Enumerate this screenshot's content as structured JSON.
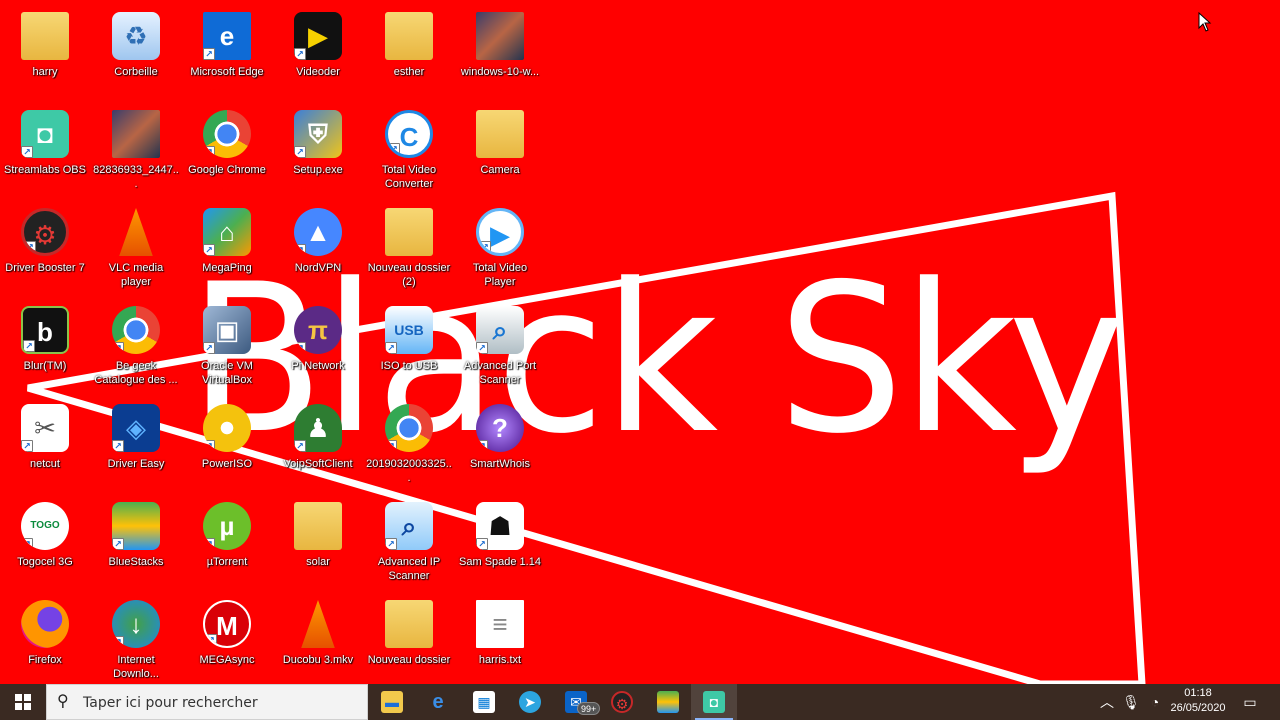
{
  "wallpaper": {
    "text": "Black Sky",
    "background": "#ff0000"
  },
  "desktop_icons": [
    {
      "label": "harry",
      "icon": "folder-icon"
    },
    {
      "label": "Corbeille",
      "icon": "recycle-bin-icon"
    },
    {
      "label": "Microsoft Edge",
      "icon": "edge-icon"
    },
    {
      "label": "Videoder",
      "icon": "videoder-icon"
    },
    {
      "label": "esther",
      "icon": "folder-icon"
    },
    {
      "label": "windows-10-w...",
      "icon": "image-file-icon"
    },
    {
      "label": "Streamlabs OBS",
      "icon": "streamlabs-icon"
    },
    {
      "label": "82836933_2447...",
      "icon": "image-file-icon"
    },
    {
      "label": "Google Chrome",
      "icon": "chrome-icon"
    },
    {
      "label": "Setup.exe",
      "icon": "setup-icon"
    },
    {
      "label": "Total Video Converter",
      "icon": "total-video-converter-icon"
    },
    {
      "label": "Camera",
      "icon": "folder-icon"
    },
    {
      "label": "Driver Booster 7",
      "icon": "driver-booster-icon"
    },
    {
      "label": "VLC media player",
      "icon": "vlc-icon"
    },
    {
      "label": "MegaPing",
      "icon": "megaping-icon"
    },
    {
      "label": "NordVPN",
      "icon": "nordvpn-icon"
    },
    {
      "label": "Nouveau dossier (2)",
      "icon": "folder-icon"
    },
    {
      "label": "Total Video Player",
      "icon": "total-video-player-icon"
    },
    {
      "label": "Blur(TM)",
      "icon": "blur-icon"
    },
    {
      "label": "Be geek Catalogue des ...",
      "icon": "chrome-icon"
    },
    {
      "label": "Oracle VM VirtualBox",
      "icon": "virtualbox-icon"
    },
    {
      "label": "Pi Network",
      "icon": "pi-network-icon"
    },
    {
      "label": "ISO to USB",
      "icon": "iso-to-usb-icon"
    },
    {
      "label": "Advanced Port Scanner",
      "icon": "port-scanner-icon"
    },
    {
      "label": "netcut",
      "icon": "netcut-icon"
    },
    {
      "label": "Driver Easy",
      "icon": "driver-easy-icon"
    },
    {
      "label": "PowerISO",
      "icon": "poweriso-icon"
    },
    {
      "label": "VoipSoftClient",
      "icon": "voip-icon"
    },
    {
      "label": "2019032003325...",
      "icon": "chrome-icon"
    },
    {
      "label": "SmartWhois",
      "icon": "smartwhois-icon"
    },
    {
      "label": "Togocel 3G",
      "icon": "togocel-icon"
    },
    {
      "label": "BlueStacks",
      "icon": "bluestacks-icon"
    },
    {
      "label": "µTorrent",
      "icon": "utorrent-icon"
    },
    {
      "label": "solar",
      "icon": "folder-icon"
    },
    {
      "label": "Advanced IP Scanner",
      "icon": "ip-scanner-icon"
    },
    {
      "label": "Sam Spade 1.14",
      "icon": "sam-spade-icon"
    },
    {
      "label": "Firefox",
      "icon": "firefox-icon"
    },
    {
      "label": "Internet Downlo...",
      "icon": "idm-icon"
    },
    {
      "label": "MEGAsync",
      "icon": "megasync-icon"
    },
    {
      "label": "Ducobu 3.mkv",
      "icon": "vlc-icon"
    },
    {
      "label": "Nouveau dossier",
      "icon": "folder-icon"
    },
    {
      "label": "harris.txt",
      "icon": "text-file-icon"
    }
  ],
  "taskbar": {
    "search_placeholder": "Taper ici pour rechercher",
    "apps": [
      {
        "name": "file-explorer",
        "icon": "folder-icon"
      },
      {
        "name": "edge",
        "icon": "edge-icon"
      },
      {
        "name": "store",
        "icon": "store-icon"
      },
      {
        "name": "telegram",
        "icon": "telegram-icon"
      },
      {
        "name": "mail",
        "icon": "mail-icon",
        "badge": "99+"
      },
      {
        "name": "driver-booster",
        "icon": "driver-booster-icon"
      },
      {
        "name": "bluestacks",
        "icon": "bluestacks-icon"
      },
      {
        "name": "streamlabs",
        "icon": "streamlabs-icon"
      }
    ],
    "time": "01:18",
    "date": "26/05/2020"
  }
}
